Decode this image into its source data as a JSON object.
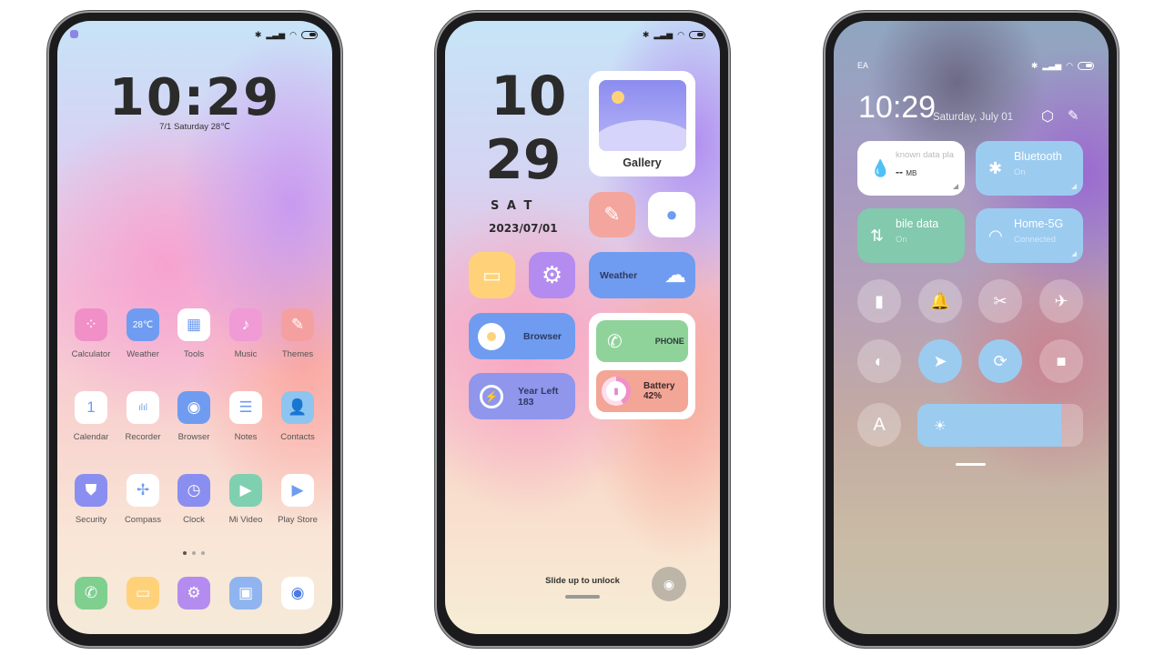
{
  "home": {
    "status_icons": [
      "bluetooth-icon",
      "signal-icon",
      "wifi-icon",
      "battery-icon"
    ],
    "clock": "10:29",
    "date_line": "7/1  Saturday  28℃",
    "apps": [
      {
        "label": "Calculator",
        "icon": "calculator-icon",
        "color": "#f08fc8",
        "glyph": "⁘"
      },
      {
        "label": "Weather",
        "icon": "weather-icon",
        "color": "#6f9cf0",
        "glyph": "28℃"
      },
      {
        "label": "Tools",
        "icon": "tools-icon",
        "color": "#ffffff",
        "glyph": "▦"
      },
      {
        "label": "Music",
        "icon": "music-icon",
        "color": "#f09ad6",
        "glyph": "♪"
      },
      {
        "label": "Themes",
        "icon": "themes-icon",
        "color": "#f5a0a0",
        "glyph": "✎"
      },
      {
        "label": "Calendar",
        "icon": "calendar-icon",
        "color": "#ffffff",
        "glyph": "1"
      },
      {
        "label": "Recorder",
        "icon": "recorder-icon",
        "color": "#ffffff",
        "glyph": "ılıl"
      },
      {
        "label": "Browser",
        "icon": "browser-icon",
        "color": "#6f9cf0",
        "glyph": "◉"
      },
      {
        "label": "Notes",
        "icon": "notes-icon",
        "color": "#ffffff",
        "glyph": "☰"
      },
      {
        "label": "Contacts",
        "icon": "contacts-icon",
        "color": "#8ec4f0",
        "glyph": "👤"
      },
      {
        "label": "Security",
        "icon": "security-icon",
        "color": "#8a8ef0",
        "glyph": "⛊"
      },
      {
        "label": "Compass",
        "icon": "compass-icon",
        "color": "#ffffff",
        "glyph": "✢"
      },
      {
        "label": "Clock",
        "icon": "clock-icon",
        "color": "#8a8ef0",
        "glyph": "◷"
      },
      {
        "label": "Mi Video",
        "icon": "video-icon",
        "color": "#7fd0b0",
        "glyph": "▶"
      },
      {
        "label": "Play Store",
        "icon": "play-store-icon",
        "color": "#ffffff",
        "glyph": "▶"
      }
    ],
    "dock": [
      {
        "icon": "phone-icon",
        "color": "#7fcf8f",
        "glyph": "✆"
      },
      {
        "icon": "messages-icon",
        "color": "#ffd27a",
        "glyph": "▭"
      },
      {
        "icon": "settings-icon",
        "color": "#b48cf0",
        "glyph": "⚙"
      },
      {
        "icon": "gallery-icon",
        "color": "#8fb4f0",
        "glyph": "▣"
      },
      {
        "icon": "camera-icon",
        "color": "#ffffff",
        "glyph": "◉"
      }
    ],
    "page_dots": 3,
    "active_page": 1
  },
  "lock": {
    "hour": "10",
    "minute": "29",
    "day": "S A T",
    "date": "2023/07/01",
    "gallery_label": "Gallery",
    "weather_label": "Weather",
    "browser_label": "Browser",
    "year_left_label": "Year Left",
    "year_left_value": "183",
    "phone_label": "PHONE",
    "battery_label": "Battery",
    "battery_value": "42%",
    "battery_level": 42,
    "unlock_hint": "Slide up to unlock"
  },
  "control": {
    "carrier": "EA",
    "clock": "10:29",
    "date": "Saturday, July 01",
    "data_plan": {
      "title": "known data pla",
      "value": "--",
      "unit": "MB"
    },
    "bluetooth": {
      "title": "Bluetooth",
      "status": "On"
    },
    "mobile_data": {
      "title": "bile data",
      "status": "On"
    },
    "wifi": {
      "title": "Home-5G",
      "status": "Connected"
    },
    "toggles": [
      {
        "icon": "flashlight-icon",
        "glyph": "▮",
        "on": false
      },
      {
        "icon": "bell-icon",
        "glyph": "🔔",
        "on": false
      },
      {
        "icon": "screenshot-icon",
        "glyph": "✂",
        "on": false
      },
      {
        "icon": "airplane-icon",
        "glyph": "✈",
        "on": false
      },
      {
        "icon": "dark-mode-icon",
        "glyph": "◐",
        "on": false
      },
      {
        "icon": "location-icon",
        "glyph": "➤",
        "on": true
      },
      {
        "icon": "rotation-lock-icon",
        "glyph": "⟳",
        "on": true
      },
      {
        "icon": "video-camera-icon",
        "glyph": "■",
        "on": false
      }
    ],
    "auto_brightness_label": "A",
    "brightness_level": 87
  }
}
